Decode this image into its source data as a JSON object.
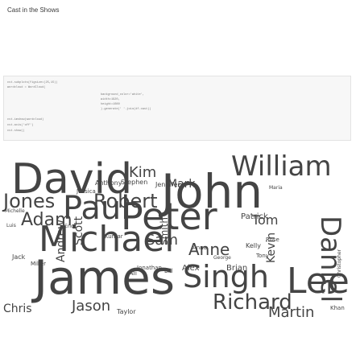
{
  "page": {
    "title": "Cast in the Shows"
  },
  "code_cells": [
    "cst.subplots(figsize=(25,15))",
    "wordcloud = WordCloud(",
    "cst.imshow(wordcloud)",
    "cst.axis('off')",
    "cst.show()"
  ],
  "sub_lines": [
    "background_color='white',",
    "width=1920,",
    "height=1080",
    ").generate(' '.join(df.cast))"
  ],
  "wordcloud": {
    "words": [
      {
        "text": "David",
        "big": true
      },
      {
        "text": "John"
      },
      {
        "text": "William"
      },
      {
        "text": "Paul"
      },
      {
        "text": "Peter"
      },
      {
        "text": "Michael"
      },
      {
        "text": "James"
      },
      {
        "text": "Singh"
      },
      {
        "text": "Lee"
      },
      {
        "text": "Robert"
      },
      {
        "text": "Daniel"
      },
      {
        "text": "Jones"
      },
      {
        "text": "Adam"
      },
      {
        "text": "Kim"
      },
      {
        "text": "Sam"
      },
      {
        "text": "Jason"
      },
      {
        "text": "Richard"
      },
      {
        "text": "Martin"
      },
      {
        "text": "Scott"
      },
      {
        "text": "Andrew"
      },
      {
        "text": "Anne"
      },
      {
        "text": "Kevin"
      },
      {
        "text": "Chris"
      },
      {
        "text": "Mark"
      },
      {
        "text": "Tom"
      },
      {
        "text": "Patrick"
      },
      {
        "text": "Smith"
      },
      {
        "text": "Alex"
      },
      {
        "text": "Anthony"
      },
      {
        "text": "Stephen"
      },
      {
        "text": "Jennifer"
      },
      {
        "text": "Ali"
      },
      {
        "text": "Bill"
      },
      {
        "text": "Jonathan"
      },
      {
        "text": "Brian"
      },
      {
        "text": "Taylor"
      },
      {
        "text": "Christopher"
      },
      {
        "text": "Kelly"
      },
      {
        "text": "Anna"
      },
      {
        "text": "Jack"
      },
      {
        "text": "Miller"
      },
      {
        "text": "Khan"
      },
      {
        "text": "Jessica"
      },
      {
        "text": "Michelle"
      },
      {
        "text": "Luis"
      },
      {
        "text": "Eric"
      },
      {
        "text": "George"
      },
      {
        "text": "Maria"
      },
      {
        "text": "Kumar"
      },
      {
        "text": "Rose"
      },
      {
        "text": "Tony"
      }
    ]
  }
}
